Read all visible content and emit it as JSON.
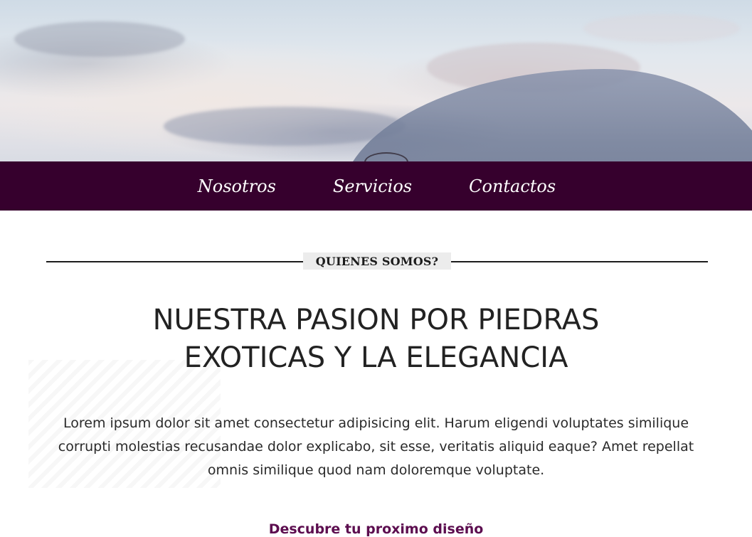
{
  "hero": {
    "image_alt": "sky-clouds-banner"
  },
  "navbar": {
    "links": [
      {
        "label": "Nosotros"
      },
      {
        "label": "Servicios"
      },
      {
        "label": "Contactos"
      }
    ],
    "background_color": "#36002d"
  },
  "about": {
    "section_label": "QUIENES SOMOS?",
    "headline_line1": "NUESTRA PASION POR PIEDRAS",
    "headline_line2": "EXOTICAS Y LA ELEGANCIA",
    "body": "Lorem ipsum dolor sit amet consectetur adipisicing elit. Harum eligendi voluptates similique corrupti molestias recusandae dolor explicabo, sit esse, veritatis aliquid eaque? Amet repellat omnis similique quod nam doloremque voluptate.",
    "cta_label": "Descubre tu proximo diseño",
    "cta_color": "#5c0d4f"
  }
}
